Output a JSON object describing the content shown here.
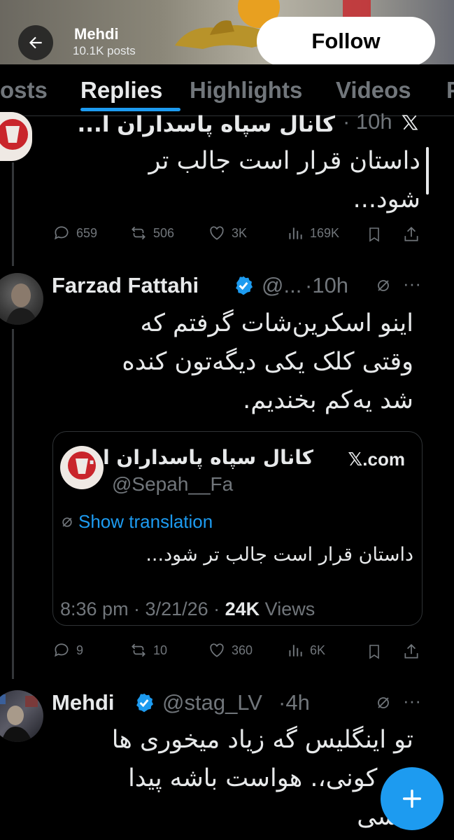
{
  "header": {
    "back_label": "Back",
    "name": "Mehdi",
    "posts_count": "10.1K posts",
    "follow_label": "Follow"
  },
  "tabs": [
    {
      "label": "osts"
    },
    {
      "label": "Replies",
      "active": true
    },
    {
      "label": "Highlights"
    },
    {
      "label": "Videos"
    },
    {
      "label": "P"
    }
  ],
  "posts": [
    {
      "author": "کانال سپاه پاسداران ا...",
      "time": "· 10h",
      "text_line1": "داستان قرار است جالب تر",
      "text_line2": "شود...",
      "actions": {
        "replies": "659",
        "reposts": "506",
        "likes": "3K",
        "views": "169K"
      }
    },
    {
      "author": "Farzad Fattahi",
      "handle": "@...",
      "time": "·10h",
      "text_line1": "اینو اسکرین‌شات گرفتم که",
      "text_line2": "وقتی کلک یکی دیگه‌تون کنده",
      "text_line3": "شد یه‌کم بخندیم.",
      "quote": {
        "name": "کانال سپاه پاسداران ا...",
        "source": "𝕏.com",
        "handle": "@Sepah__Fa",
        "translate_label": "Show translation",
        "text": "داستان قرار است جالب تر شود...",
        "timestamp": "8:36 pm · 3/21/26 · ",
        "views_count": "24K",
        "views_label": " Views"
      },
      "actions": {
        "replies": "9",
        "reposts": "10",
        "likes": "360",
        "views": "6K"
      }
    },
    {
      "author": "Mehdi",
      "handle": "@stag_LV",
      "time": "·4h",
      "text_line1": "تو اینگلیس گه زیاد میخوری ها",
      "text_line2": "چه کونی،. هواست باشه پیدا",
      "text_line3": "نیشی"
    }
  ],
  "colors": {
    "accent": "#1d9bf0",
    "background": "#000000",
    "muted": "#71767b"
  }
}
